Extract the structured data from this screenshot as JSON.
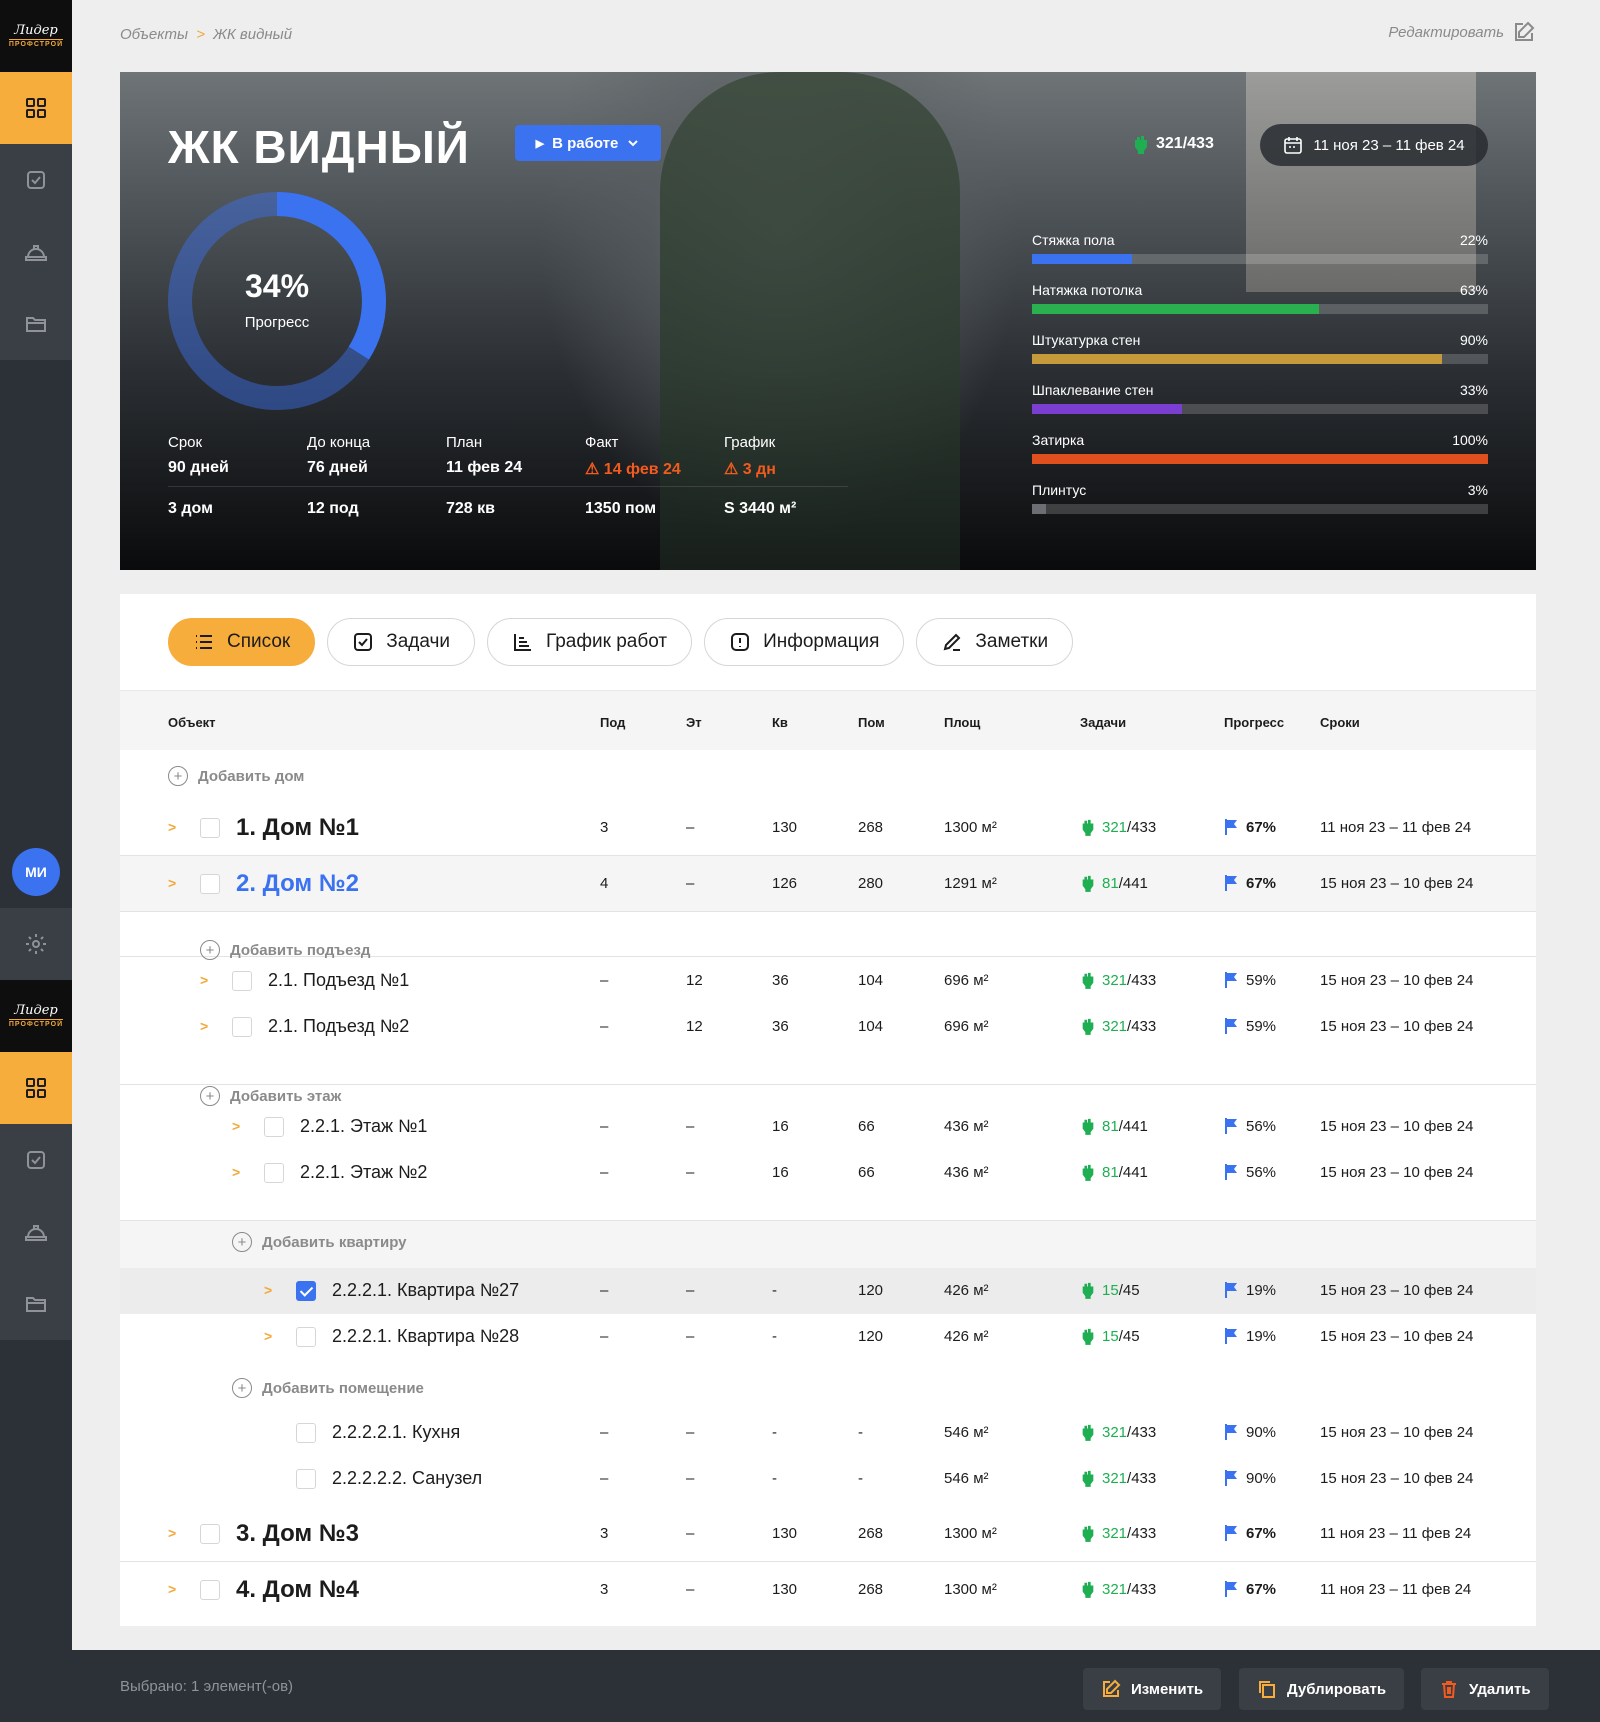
{
  "sidebar": {
    "logo_line1": "Лидер",
    "logo_line2": "ПРОФСТРОЙ",
    "avatar": "МИ"
  },
  "breadcrumb": {
    "root": "Объекты",
    "separator": ">",
    "current": "ЖК видный"
  },
  "edit_label": "Редактировать",
  "hero": {
    "title": "ЖК ВИДНЫЙ",
    "status": "В работе",
    "tasks_done": "321",
    "tasks_total": "/433",
    "date_range": "11 ноя 23 – 11 фев 24",
    "progress_value": "34%",
    "progress_percent": 34,
    "progress_label": "Прогресс",
    "stats": [
      {
        "label": "Срок",
        "value": "90 дней",
        "bottom": "3 дом",
        "warn": false
      },
      {
        "label": "До конца",
        "value": "76 дней",
        "bottom": "12 под",
        "warn": false
      },
      {
        "label": "План",
        "value": "11 фев 24",
        "bottom": "728 кв",
        "warn": false
      },
      {
        "label": "Факт",
        "value": "14 фев 24",
        "bottom": "1350 пом",
        "warn": true
      },
      {
        "label": "График",
        "value": "3 дн",
        "bottom": "S 3440 м²",
        "warn": true
      }
    ],
    "work_bars": [
      {
        "name": "Стяжка пола",
        "value": "22%",
        "pct": 22,
        "color": "#3b72f0"
      },
      {
        "name": "Натяжка потолка",
        "value": "63%",
        "pct": 63,
        "color": "#2bb04f"
      },
      {
        "name": "Штукатурка стен",
        "value": "90%",
        "pct": 90,
        "color": "#c59a3a"
      },
      {
        "name": "Шпаклевание стен",
        "value": "33%",
        "pct": 33,
        "color": "#7a3fd1"
      },
      {
        "name": "Затирка",
        "value": "100%",
        "pct": 100,
        "color": "#e0501e"
      },
      {
        "name": "Плинтус",
        "value": "3%",
        "pct": 3,
        "color": "#6b6f74"
      }
    ]
  },
  "tabs": [
    "Список",
    "Задачи",
    "График работ",
    "Информация",
    "Заметки"
  ],
  "table": {
    "headers": [
      "Объект",
      "Под",
      "Эт",
      "Кв",
      "Пом",
      "Площ",
      "Задачи",
      "Прогресс",
      "Сроки"
    ],
    "add_house": "Добавить дом",
    "add_entrance": "Добавить подъезд",
    "add_floor": "Добавить этаж",
    "add_apartment": "Добавить квартиру",
    "add_room": "Добавить помещение",
    "rows": [
      {
        "name": "1. Дом №1",
        "pod": "3",
        "et": "–",
        "kv": "130",
        "pom": "268",
        "area": "1300 м²",
        "tasks_done": "321",
        "tasks_total": "/433",
        "progress": "67%",
        "dates": "11 ноя 23 – 11 фев 24"
      },
      {
        "name": "2. Дом №2",
        "pod": "4",
        "et": "–",
        "kv": "126",
        "pom": "280",
        "area": "1291 м²",
        "tasks_done": "81",
        "tasks_total": "/441",
        "progress": "67%",
        "dates": "15 ноя 23 – 10 фев 24"
      },
      {
        "name": "2.1. Подъезд №1",
        "pod": "–",
        "et": "12",
        "kv": "36",
        "pom": "104",
        "area": "696 м²",
        "tasks_done": "321",
        "tasks_total": "/433",
        "progress": "59%",
        "dates": "15 ноя 23 – 10 фев 24"
      },
      {
        "name": "2.1. Подъезд №2",
        "pod": "–",
        "et": "12",
        "kv": "36",
        "pom": "104",
        "area": "696 м²",
        "tasks_done": "321",
        "tasks_total": "/433",
        "progress": "59%",
        "dates": "15 ноя 23 – 10 фев 24"
      },
      {
        "name": "2.2.1. Этаж №1",
        "pod": "–",
        "et": "–",
        "kv": "16",
        "pom": "66",
        "area": "436 м²",
        "tasks_done": "81",
        "tasks_total": "/441",
        "progress": "56%",
        "dates": "15 ноя 23 – 10 фев 24"
      },
      {
        "name": "2.2.1. Этаж №2",
        "pod": "–",
        "et": "–",
        "kv": "16",
        "pom": "66",
        "area": "436 м²",
        "tasks_done": "81",
        "tasks_total": "/441",
        "progress": "56%",
        "dates": "15 ноя 23 – 10 фев 24"
      },
      {
        "name": "2.2.2.1. Квартира №27",
        "pod": "–",
        "et": "–",
        "kv": "-",
        "pom": "120",
        "area": "426 м²",
        "tasks_done": "15",
        "tasks_total": "/45",
        "progress": "19%",
        "dates": "15 ноя 23 – 10 фев 24",
        "checked": true
      },
      {
        "name": "2.2.2.1. Квартира №28",
        "pod": "–",
        "et": "–",
        "kv": "-",
        "pom": "120",
        "area": "426 м²",
        "tasks_done": "15",
        "tasks_total": "/45",
        "progress": "19%",
        "dates": "15 ноя 23 – 10 фев 24"
      },
      {
        "name": "2.2.2.2.1. Кухня",
        "pod": "–",
        "et": "–",
        "kv": "-",
        "pom": "-",
        "area": "546 м²",
        "tasks_done": "321",
        "tasks_total": "/433",
        "progress": "90%",
        "dates": "15 ноя 23 – 10 фев 24"
      },
      {
        "name": "2.2.2.2.2. Санузел",
        "pod": "–",
        "et": "–",
        "kv": "-",
        "pom": "-",
        "area": "546 м²",
        "tasks_done": "321",
        "tasks_total": "/433",
        "progress": "90%",
        "dates": "15 ноя 23 – 10 фев 24"
      },
      {
        "name": "3. Дом №3",
        "pod": "3",
        "et": "–",
        "kv": "130",
        "pom": "268",
        "area": "1300 м²",
        "tasks_done": "321",
        "tasks_total": "/433",
        "progress": "67%",
        "dates": "11 ноя 23 – 11 фев 24"
      },
      {
        "name": "4. Дом №4",
        "pod": "3",
        "et": "–",
        "kv": "130",
        "pom": "268",
        "area": "1300 м²",
        "tasks_done": "321",
        "tasks_total": "/433",
        "progress": "67%",
        "dates": "11 ноя 23 – 11 фев 24"
      }
    ]
  },
  "bottom_bar": {
    "selected": "Выбрано: 1 элемент(-ов)",
    "change": "Изменить",
    "duplicate": "Дублировать",
    "delete": "Удалить"
  }
}
